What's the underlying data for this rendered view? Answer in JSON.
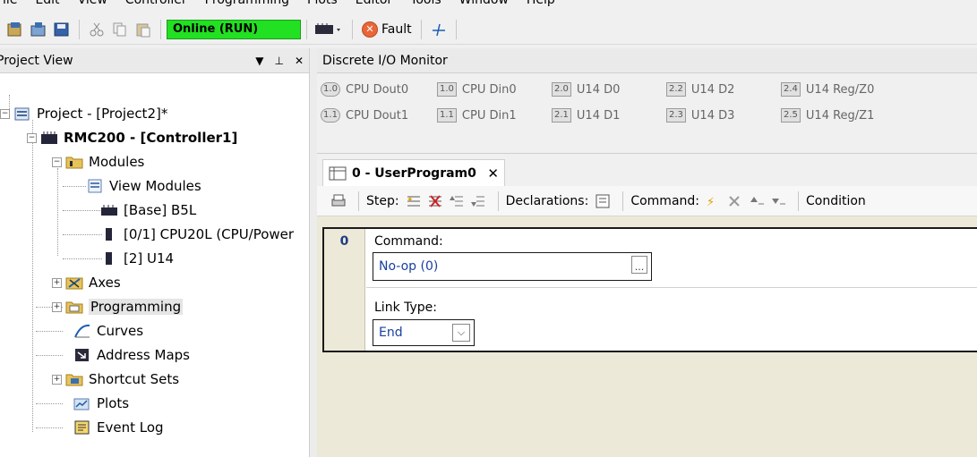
{
  "menu": [
    "File",
    "Edit",
    "View",
    "Controller",
    "Programming",
    "Plots",
    "Editor",
    "Tools",
    "Window",
    "Help"
  ],
  "toolbar": {
    "status": "Online (RUN)",
    "fault_label": "Fault"
  },
  "project_view": {
    "title": "Project View",
    "pin": "ᵖ",
    "close": "✕",
    "tree": {
      "project": "Project - [Project2]*",
      "controller": "RMC200 - [Controller1]",
      "modules": "Modules",
      "view_modules": "View Modules",
      "base": "[Base] B5L",
      "cpu": "[0/1] CPU20L (CPU/Power",
      "u14": "[2] U14",
      "axes": "Axes",
      "programming": "Programming",
      "curves": "Curves",
      "address_maps": "Address Maps",
      "shortcut_sets": "Shortcut Sets",
      "plots": "Plots",
      "event_log": "Event Log"
    }
  },
  "io_monitor": {
    "title": "Discrete I/O Monitor",
    "items": [
      {
        "code": "1.0",
        "label": "CPU Dout0",
        "round": true
      },
      {
        "code": "1.0",
        "label": "CPU Din0",
        "round": false
      },
      {
        "code": "2.0",
        "label": "U14 D0",
        "round": false
      },
      {
        "code": "2.2",
        "label": "U14 D2",
        "round": false
      },
      {
        "code": "2.4",
        "label": "U14 Reg/Z0",
        "round": false
      },
      {
        "code": "1.1",
        "label": "CPU Dout1",
        "round": true
      },
      {
        "code": "1.1",
        "label": "CPU Din1",
        "round": false
      },
      {
        "code": "2.1",
        "label": "U14 D1",
        "round": false
      },
      {
        "code": "2.3",
        "label": "U14 D3",
        "round": false
      },
      {
        "code": "2.5",
        "label": "U14 Reg/Z1",
        "round": false
      }
    ]
  },
  "editor": {
    "tab_label": "0 - UserProgram0",
    "tab_close": "✕",
    "step_label": "Step:",
    "declarations_label": "Declarations:",
    "command_label": "Command:",
    "condition_label": "Condition",
    "step_number": "0",
    "command_field_label": "Command:",
    "command_value": "No-op (0)",
    "command_button": "...",
    "link_type_label": "Link Type:",
    "link_type_value": "End",
    "link_type_arrow": "⌵"
  }
}
